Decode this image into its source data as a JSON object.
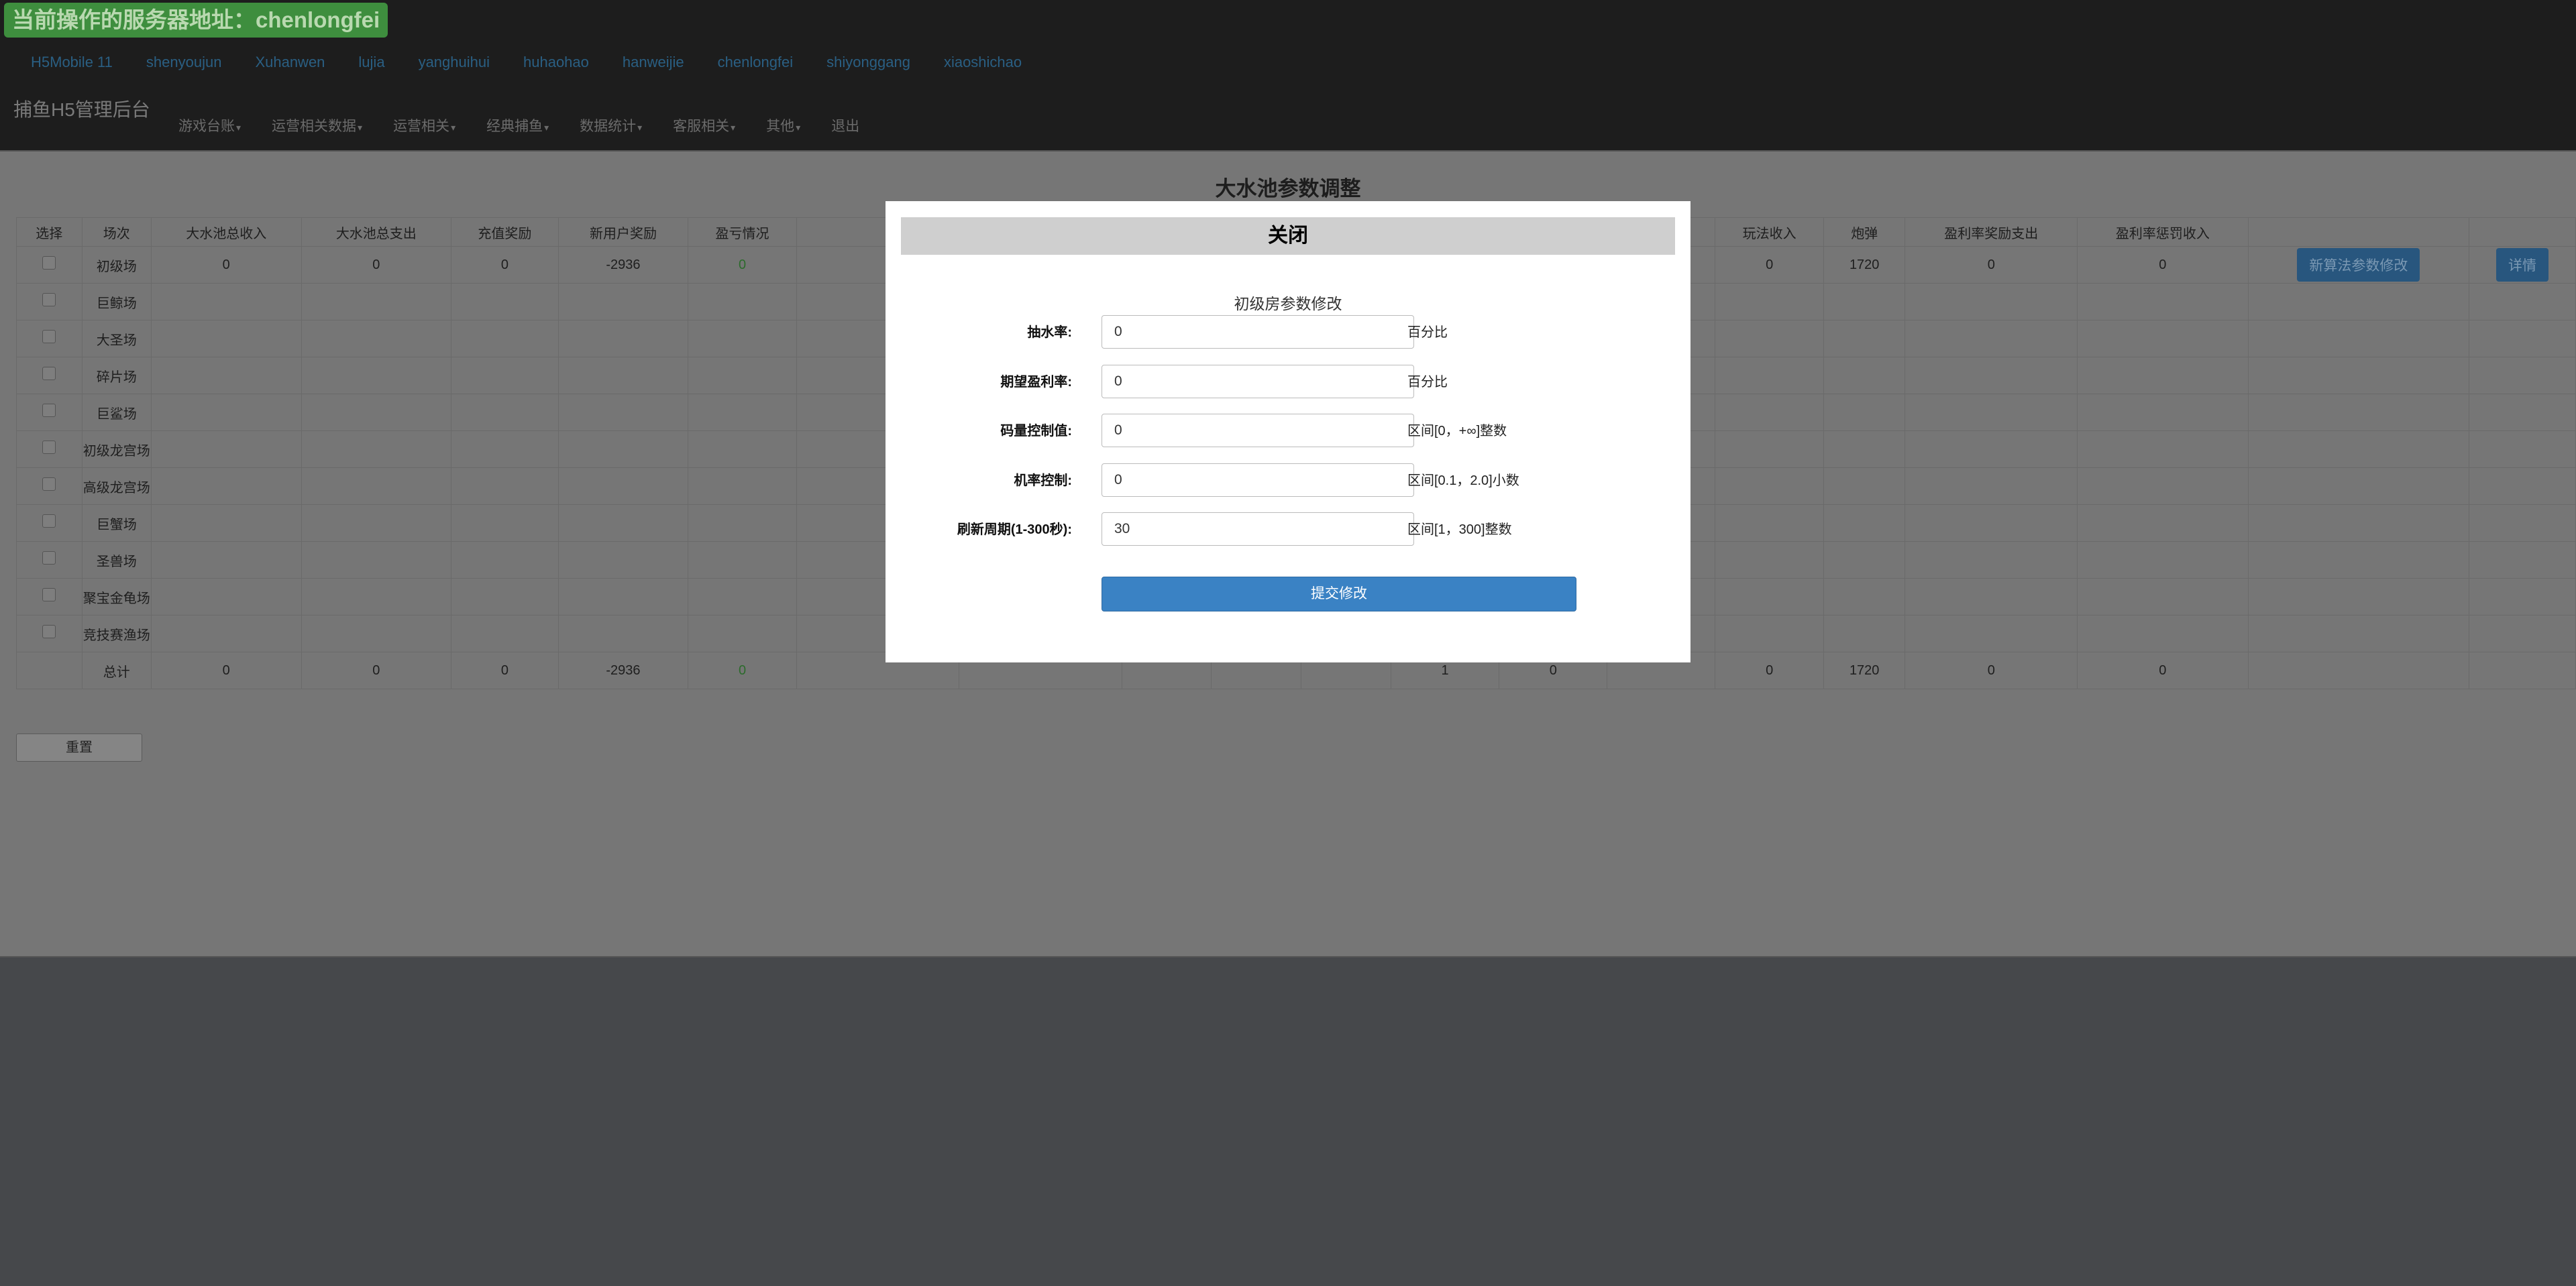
{
  "header": {
    "server_badge": "当前操作的服务器地址：chenlongfei",
    "servers": [
      "H5Mobile 11",
      "shenyoujun",
      "Xuhanwen",
      "lujia",
      "yanghuihui",
      "huhaohao",
      "hanweijie",
      "chenlongfei",
      "shiyonggang",
      "xiaoshichao"
    ],
    "brand": "捕鱼H5管理后台",
    "nav": [
      {
        "label": "游戏台账",
        "dropdown": true
      },
      {
        "label": "运营相关数据",
        "dropdown": true
      },
      {
        "label": "运营相关",
        "dropdown": true
      },
      {
        "label": "经典捕鱼",
        "dropdown": true
      },
      {
        "label": "数据统计",
        "dropdown": true
      },
      {
        "label": "客服相关",
        "dropdown": true
      },
      {
        "label": "其他",
        "dropdown": true
      },
      {
        "label": "退出",
        "dropdown": false
      }
    ]
  },
  "main": {
    "title": "大水池参数调整",
    "headers": [
      "选择",
      "场次",
      "大水池总收入",
      "大水池总支出",
      "充值奖励",
      "新用户奖励",
      "盈亏情况",
      "",
      "",
      "",
      "",
      "",
      "",
      "",
      "",
      "玩法收入",
      "炮弹",
      "盈利率奖励支出",
      "盈利率惩罚收入",
      "",
      ""
    ],
    "rows": [
      {
        "name": "初级场",
        "c2": "0",
        "c3": "0",
        "c4": "0",
        "c5": "-2936",
        "c6": "0",
        "c15": "0",
        "c16": "1720",
        "c17": "0",
        "c18": "0",
        "btn1": "新算法参数修改",
        "btn2": "详情"
      },
      {
        "name": "巨鲸场"
      },
      {
        "name": "大圣场"
      },
      {
        "name": "碎片场"
      },
      {
        "name": "巨鲨场"
      },
      {
        "name": "初级龙宫场"
      },
      {
        "name": "高级龙宫场"
      },
      {
        "name": "巨蟹场"
      },
      {
        "name": "圣兽场"
      },
      {
        "name": "聚宝金龟场"
      },
      {
        "name": "竞技赛渔场"
      }
    ],
    "total": {
      "name": "总计",
      "c2": "0",
      "c3": "0",
      "c4": "0",
      "c5": "-2936",
      "c6": "0",
      "c12": "1",
      "c13": "0",
      "c15": "0",
      "c16": "1720",
      "c17": "0",
      "c18": "0"
    },
    "reset_label": "重置"
  },
  "modal": {
    "close_label": "关闭",
    "title": "初级房参数修改",
    "fields": [
      {
        "label": "抽水率:",
        "value": "0",
        "hint": "百分比"
      },
      {
        "label": "期望盈利率:",
        "value": "0",
        "hint": "百分比"
      },
      {
        "label": "码量控制值:",
        "value": "0",
        "hint": "区间[0，+∞]整数"
      },
      {
        "label": "机率控制:",
        "value": "0",
        "hint": "区间[0.1，2.0]小数"
      },
      {
        "label": "刷新周期(1-300秒):",
        "value": "30",
        "hint": "区间[1，300]整数"
      }
    ],
    "submit_label": "提交修改"
  }
}
